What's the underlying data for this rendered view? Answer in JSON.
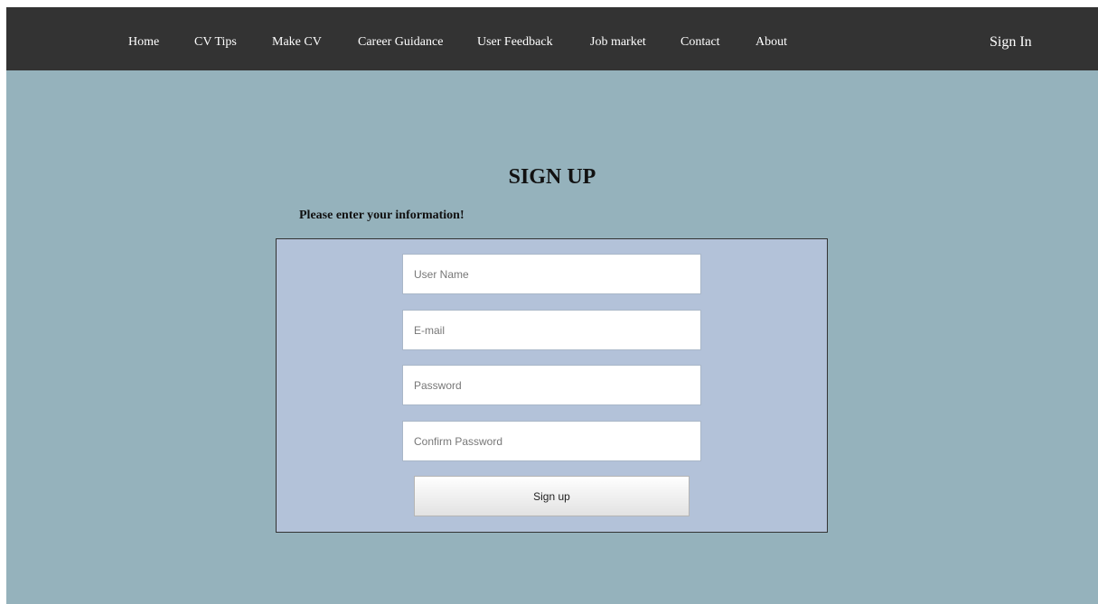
{
  "nav": {
    "items": [
      {
        "label": "Home"
      },
      {
        "label": "CV Tips"
      },
      {
        "label": "Make CV"
      },
      {
        "label": "Career Guidance"
      },
      {
        "label": "User Feedback"
      },
      {
        "label": "Job market"
      },
      {
        "label": "Contact"
      },
      {
        "label": "About"
      }
    ],
    "signin_label": "Sign In"
  },
  "page": {
    "title": "SIGN UP",
    "subtitle": "Please enter your information!"
  },
  "form": {
    "username": {
      "placeholder": "User Name",
      "value": ""
    },
    "email": {
      "placeholder": "E-mail",
      "value": ""
    },
    "password": {
      "placeholder": "Password",
      "value": ""
    },
    "confirm_password": {
      "placeholder": "Confirm Password",
      "value": ""
    },
    "submit_label": "Sign up"
  },
  "colors": {
    "navbar": "#333333",
    "page_background": "#95b2bc",
    "form_background": "#b3c2d9",
    "nav_text": "#ffffff"
  }
}
